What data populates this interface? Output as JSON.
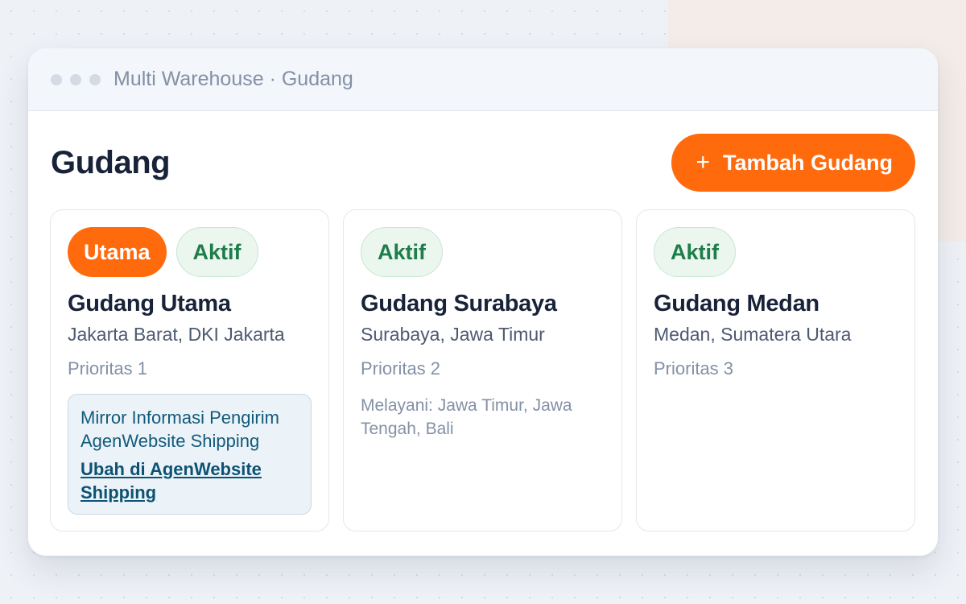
{
  "window": {
    "title": "Multi Warehouse · Gudang"
  },
  "page": {
    "title": "Gudang",
    "add_button": {
      "icon": "plus-icon",
      "label": "Tambah Gudang"
    }
  },
  "colors": {
    "accent": "#ff6a0d",
    "active_badge_text": "#1e7d4a",
    "active_badge_bg": "#eaf6ee",
    "info_text": "#125a7a"
  },
  "warehouses": [
    {
      "badges": [
        "Utama",
        "Aktif"
      ],
      "name": "Gudang Utama",
      "location": "Jakarta Barat, DKI Jakarta",
      "priority": "Prioritas 1",
      "mirror_text": "Mirror Informasi Pengirim AgenWebsite Shipping",
      "mirror_link": "Ubah di AgenWebsite Shipping"
    },
    {
      "badges": [
        "Aktif"
      ],
      "name": "Gudang Surabaya",
      "location": "Surabaya, Jawa Timur",
      "priority": "Prioritas 2",
      "serves": "Melayani: Jawa Timur, Jawa Tengah, Bali"
    },
    {
      "badges": [
        "Aktif"
      ],
      "name": "Gudang Medan",
      "location": "Medan, Sumatera Utara",
      "priority": "Prioritas 3"
    }
  ]
}
